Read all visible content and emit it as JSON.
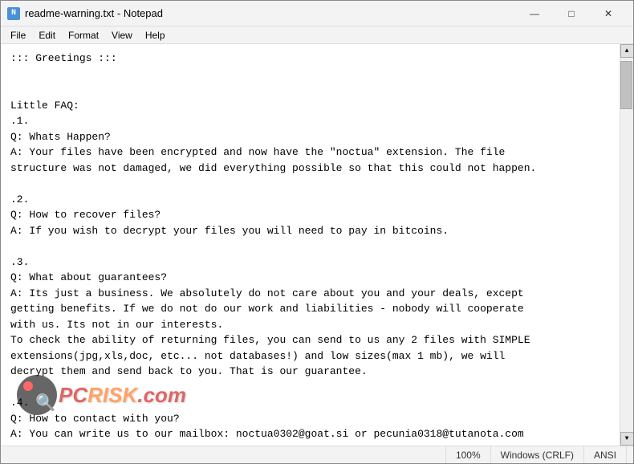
{
  "window": {
    "title": "readme-warning.txt - Notepad",
    "icon_label": "N"
  },
  "title_buttons": {
    "minimize": "—",
    "maximize": "□",
    "close": "✕"
  },
  "menu": {
    "items": [
      "File",
      "Edit",
      "Format",
      "View",
      "Help"
    ]
  },
  "content": "::: Greetings :::\n\n\nLittle FAQ:\n.1.\nQ: Whats Happen?\nA: Your files have been encrypted and now have the \"noctua\" extension. The file\nstructure was not damaged, we did everything possible so that this could not happen.\n\n.2.\nQ: How to recover files?\nA: If you wish to decrypt your files you will need to pay in bitcoins.\n\n.3.\nQ: What about guarantees?\nA: Its just a business. We absolutely do not care about you and your deals, except\ngetting benefits. If we do not do our work and liabilities - nobody will cooperate\nwith us. Its not in our interests.\nTo check the ability of returning files, you can send to us any 2 files with SIMPLE\nextensions(jpg,xls,doc, etc... not databases!) and low sizes(max 1 mb), we will\ndecrypt them and send back to you. That is our guarantee.\n\n.4.\nQ: How to contact with you?\nA: You can write us to our mailbox: noctua0302@goat.si or pecunia0318@tutanota.com",
  "status": {
    "zoom": "100%",
    "line_ending": "Windows (CRLF)",
    "encoding": "ANSI"
  },
  "watermark": {
    "text_pc": "PC",
    "text_risk": "RISK",
    "text_com": ".com"
  }
}
